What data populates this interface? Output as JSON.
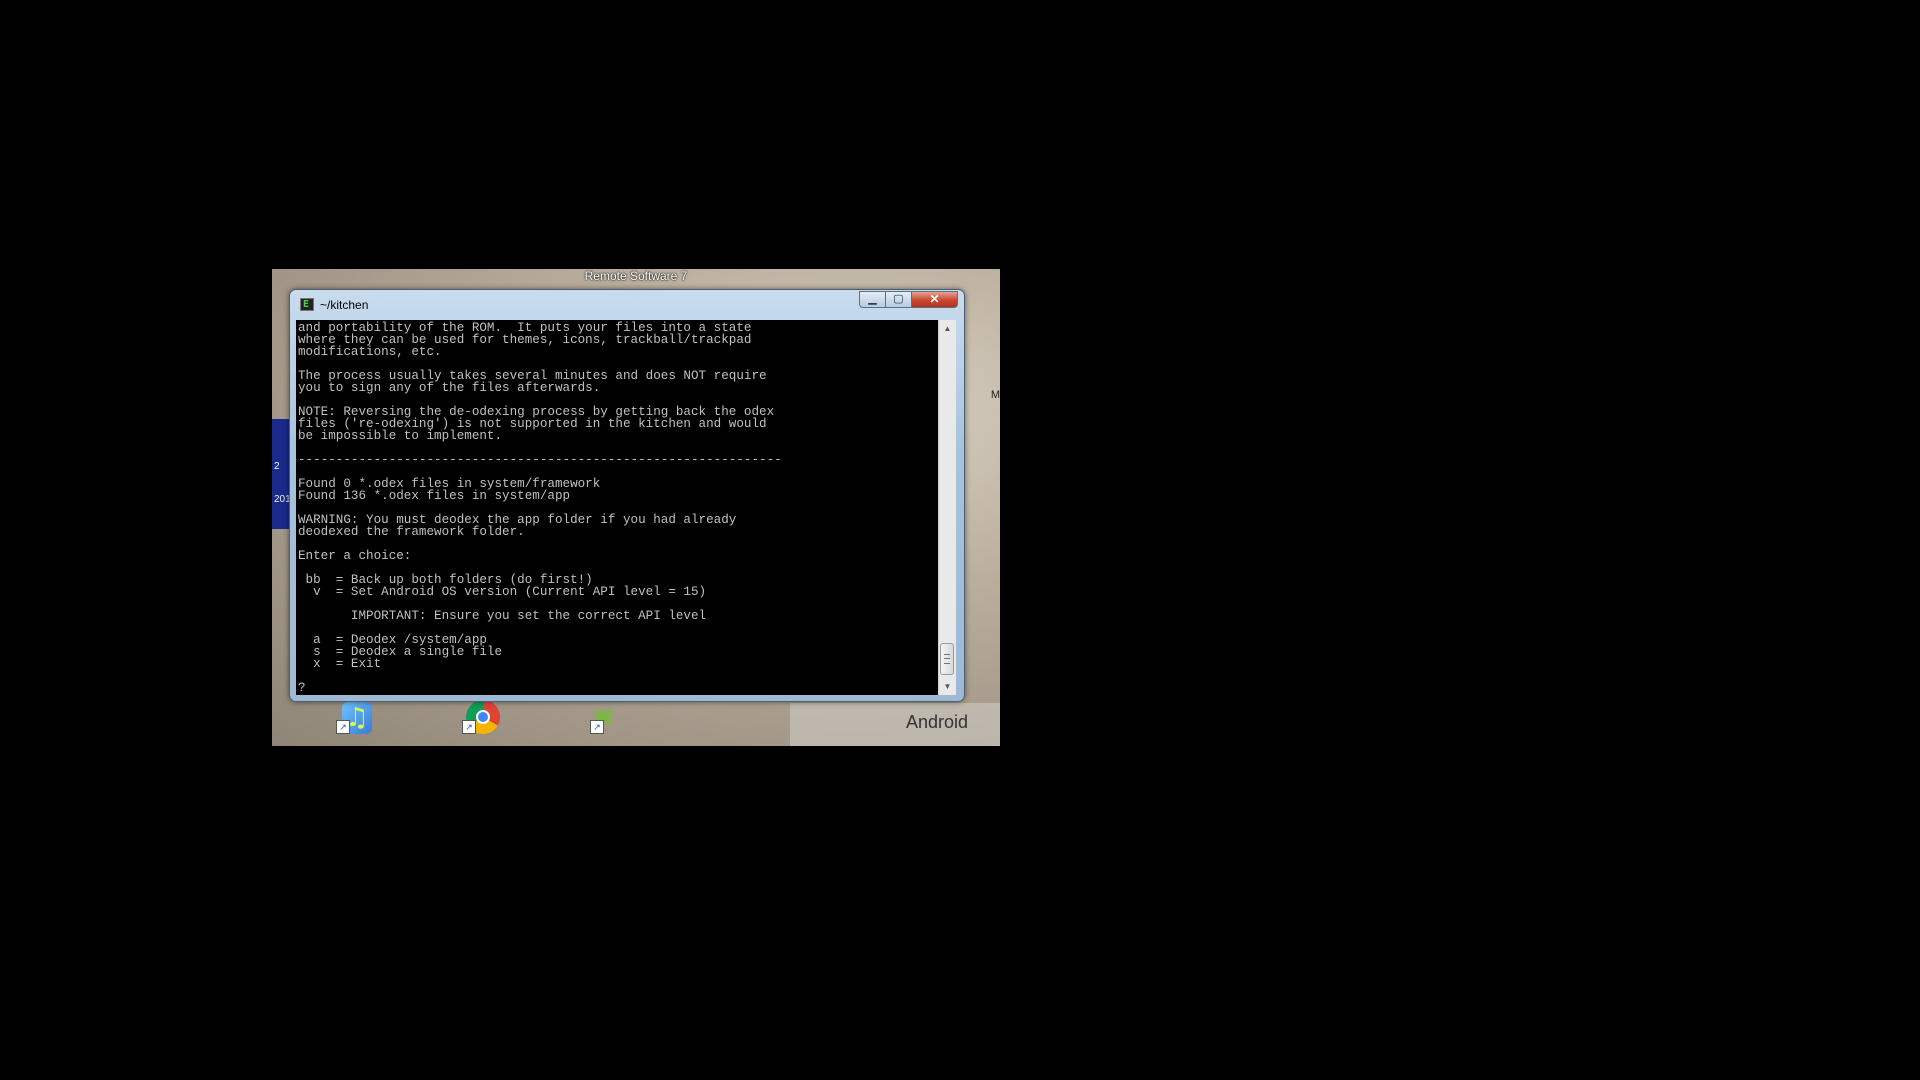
{
  "remote": {
    "title": "Remote Software 7",
    "left_glyph": "2",
    "left_glyph2": "201",
    "right_glyph": "M"
  },
  "window": {
    "title": "~/kitchen",
    "icon_glyph": "E",
    "minimize_symbol": "▁",
    "maximize_symbol": "▢",
    "close_symbol": "✕"
  },
  "console": {
    "lines": [
      "and portability of the ROM.  It puts your files into a state",
      "where they can be used for themes, icons, trackball/trackpad",
      "modifications, etc.",
      "",
      "The process usually takes several minutes and does NOT require",
      "you to sign any of the files afterwards.",
      "",
      "NOTE: Reversing the de-odexing process by getting back the odex",
      "files ('re-odexing') is not supported in the kitchen and would",
      "be impossible to implement.",
      "",
      "----------------------------------------------------------------",
      "",
      "Found 0 *.odex files in system/framework",
      "Found 136 *.odex files in system/app",
      "",
      "WARNING: You must deodex the app folder if you had already",
      "deodexed the framework folder.",
      "",
      "Enter a choice:",
      "",
      " bb  = Back up both folders (do first!)",
      "  v  = Set Android OS version (Current API level = 15)",
      "",
      "       IMPORTANT: Ensure you set the correct API level",
      "",
      "  a  = Deodex /system/app",
      "  s  = Deodex a single file",
      "  x  = Exit",
      "",
      "?"
    ]
  },
  "scrollbar": {
    "up_arrow": "▲",
    "down_arrow": "▼"
  },
  "desktop": {
    "icons": [
      {
        "name": "itunes",
        "glyph": "♫",
        "shortcut": "↗"
      },
      {
        "name": "chrome",
        "shortcut": "↗"
      },
      {
        "name": "android-tool",
        "glyph": "▣",
        "shortcut": "↗"
      }
    ],
    "android_label": "Android"
  }
}
